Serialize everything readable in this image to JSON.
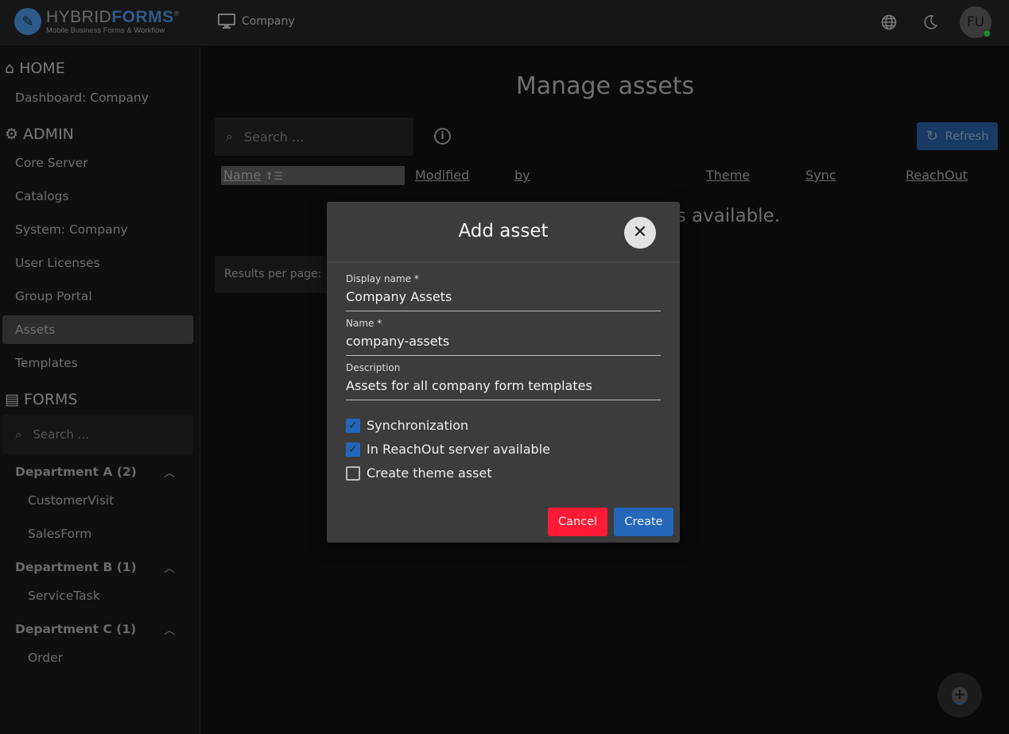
{
  "header": {
    "logo_main_light": "HYBRID",
    "logo_main_bold": "FORMS",
    "logo_reg": "®",
    "logo_sub": "Mobile Business Forms & Workflow",
    "breadcrumb": "Company",
    "avatar_initials": "FU"
  },
  "sidebar": {
    "home_heading": "HOME",
    "home_items": [
      "Dashboard: Company"
    ],
    "admin_heading": "ADMIN",
    "admin_items": [
      "Core Server",
      "Catalogs",
      "System: Company",
      "User Licenses",
      "Group Portal",
      "Assets",
      "Templates"
    ],
    "active_item": "Assets",
    "forms_heading": "FORMS",
    "search_placeholder": "Search ...",
    "groups": [
      {
        "label": "Department A (2)",
        "items": [
          "CustomerVisit",
          "SalesForm"
        ]
      },
      {
        "label": "Department B (1)",
        "items": [
          "ServiceTask"
        ]
      },
      {
        "label": "Department C (1)",
        "items": [
          "Order"
        ]
      }
    ]
  },
  "main": {
    "title": "Manage assets",
    "search_placeholder": "Search ...",
    "refresh_label": "Refresh",
    "columns": [
      "Name",
      "Modified",
      "by",
      "Theme",
      "Sync",
      "ReachOut"
    ],
    "empty_message": "No assets available.",
    "results_per_page_label": "Results per page:"
  },
  "dialog": {
    "title": "Add asset",
    "fields": [
      {
        "label": "Display name *",
        "value": "Company Assets"
      },
      {
        "label": "Name *",
        "value": "company-assets"
      },
      {
        "label": "Description",
        "value": "Assets for all company form templates"
      }
    ],
    "checkboxes": [
      {
        "label": "Synchronization",
        "checked": true
      },
      {
        "label": "In ReachOut server available",
        "checked": true
      },
      {
        "label": "Create theme asset",
        "checked": false
      }
    ],
    "cancel_label": "Cancel",
    "create_label": "Create"
  },
  "colors": {
    "accent": "#2466b8",
    "danger": "#ff1a36",
    "brand": "#2e5a8a"
  }
}
